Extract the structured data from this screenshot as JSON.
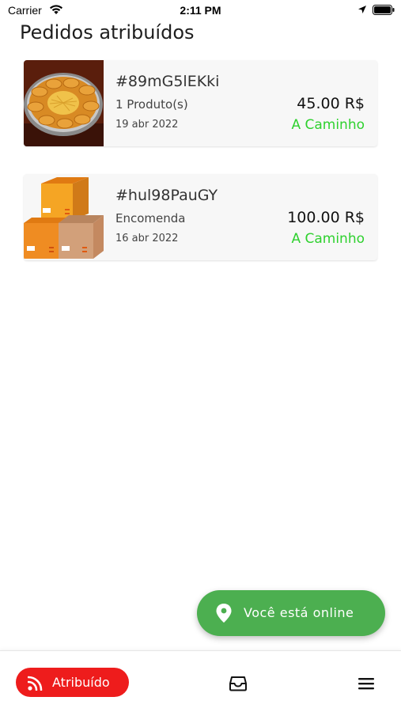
{
  "status_bar": {
    "carrier": "Carrier",
    "time": "2:11 PM"
  },
  "page_title": "Pedidos atribuídos",
  "orders": [
    {
      "id": "#89mG5lEKki",
      "subtitle": "1 Produto(s)",
      "date": "19 abr 2022",
      "price": "45.00 R$",
      "status": "A Caminho",
      "thumbnail": "fried-food-platter"
    },
    {
      "id": "#hul98PauGY",
      "subtitle": "Encomenda",
      "date": "16 abr 2022",
      "price": "100.00 R$",
      "status": "A Caminho",
      "thumbnail": "package-boxes"
    }
  ],
  "online_button": {
    "label": "Você está online",
    "icon": "location-pin-icon"
  },
  "bottom_nav": {
    "active_label": "Atribuído",
    "active_icon": "rss-icon",
    "items": [
      "inbox-icon",
      "menu-icon"
    ]
  },
  "colors": {
    "status_green": "#2fd12f",
    "fab_green": "#4caf50",
    "nav_red": "#ee1c1c"
  }
}
